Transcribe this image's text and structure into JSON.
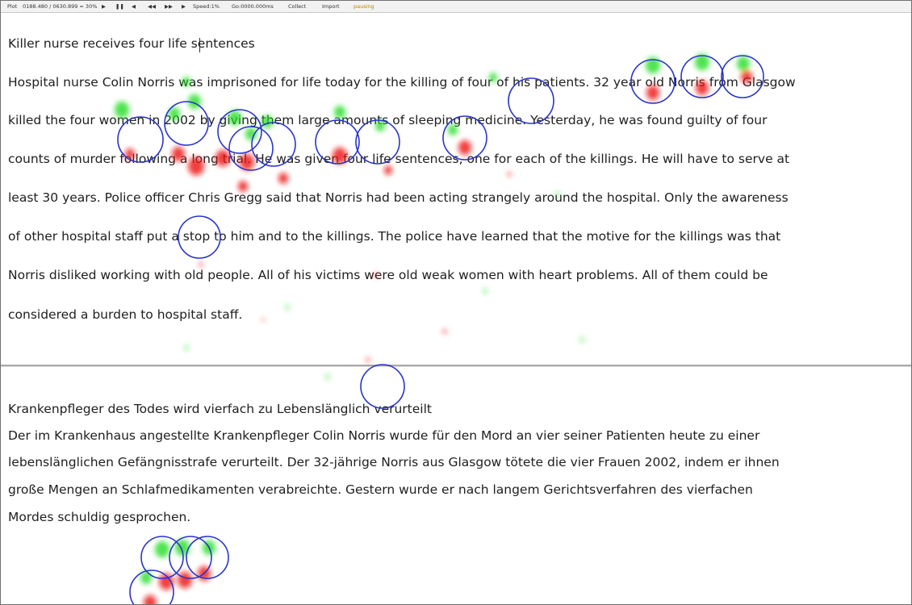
{
  "toolbar": {
    "plot_label": "Plot",
    "time_readout": "0188.480 / 0630.899 = 30%",
    "speed_label": "Speed:1%",
    "go_label": "Go:0000.000ms",
    "collect_label": "Collect",
    "import_label": "Import",
    "status": "pausing"
  },
  "english": {
    "title": "Killer nurse receives four life sentences",
    "lines": [
      "Hospital nurse Colin Norris was imprisoned for life today for the killing of four of his patients. 32 year old Norris from Glasgow",
      "killed the four women in 2002 by giving them large amounts of sleeping medicine. Yesterday, he was found guilty of four",
      "counts of murder following a long trial. He was given four life sentences, one for each of the killings. He will have to serve at",
      "least 30 years. Police officer Chris Gregg said that Norris had been acting strangely around the hospital. Only the awareness",
      "of other hospital staff put a stop to him and to the killings. The police have learned that the motive for the killings was that",
      "Norris disliked working with old people. All of his victims were old weak women with heart problems. All of them could be",
      "considered a burden to hospital staff."
    ]
  },
  "german": {
    "title": "Krankenpfleger des Todes wird vierfach zu Lebenslänglich verurteilt",
    "lines": [
      "Der im Krankenhaus angestellte Krankenpfleger Colin Norris wurde für den Mord an vier seiner Patienten heute zu einer",
      "lebenslänglichen Gefängnisstrafe verurteilt. Der 32-jährige Norris aus Glasgow tötete die vier Frauen 2002, indem er ihnen",
      "große Mengen an Schlafmedikamenten verabreichte. Gestern wurde er nach langem Gerichtsverfahren des vierfachen",
      "Mordes schuldig gesprochen."
    ]
  },
  "overlay": {
    "circle_color": "#2a35c9",
    "start_color": "#22dd22",
    "end_color": "#ee1111"
  }
}
